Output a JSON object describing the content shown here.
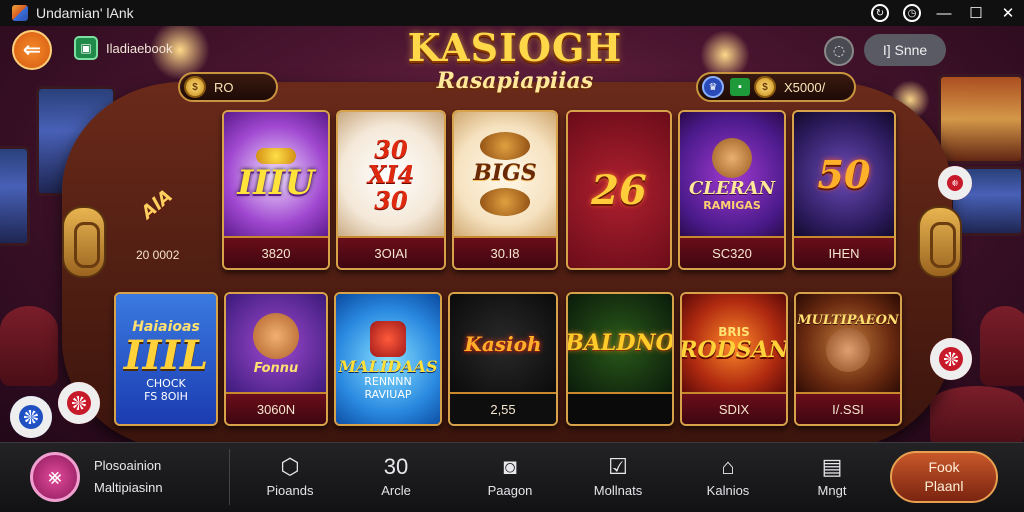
{
  "window": {
    "title": "Undamian' lAnk"
  },
  "header": {
    "back_icon": "arrow-left-icon",
    "book_label": "Iladiaebook",
    "logo_title": "KASIOGH",
    "logo_subtitle": "Rasapiapiias",
    "sign_label": "I] Snne"
  },
  "balances": {
    "left_value": "RO",
    "right_value": "X5000/"
  },
  "table": {
    "side_text": "AlA",
    "count_label": "20  0002"
  },
  "cards_top": [
    {
      "art": "IIIU",
      "caption": "3820"
    },
    {
      "art": "30\nXI4\n30",
      "caption": "3OIAI"
    },
    {
      "art": "BIGS",
      "caption": "30.I8"
    },
    {
      "art": "26",
      "caption": ""
    },
    {
      "art": "CLERAN",
      "art_sub": "RAMIGAS",
      "caption": "SC320"
    },
    {
      "art": "50",
      "caption": "IHEN"
    }
  ],
  "cards_bottom": [
    {
      "art_sub": "Haiaioas",
      "art": "IIIL",
      "art_sub2": "CHOCK\nFS 8OIH",
      "caption": ""
    },
    {
      "art": "Fonnu",
      "caption": "3060N"
    },
    {
      "art": "MALIDAAS",
      "art_sub": "RENNNN\nRAVIUAP",
      "caption": ""
    },
    {
      "art": "Kasioh",
      "caption": "2,55"
    },
    {
      "art": "BALDNO",
      "caption": ""
    },
    {
      "art_sub": "BRIS",
      "art": "RODSAN",
      "caption": "SDIX"
    },
    {
      "art": "MULTIPAEON",
      "caption": "I/.SSI"
    }
  ],
  "bottom_nav": {
    "promo_line1": "Plosoainion",
    "promo_line2": "Maltipiasinn",
    "items": [
      {
        "label": "Pioands",
        "icon": "chip-icon"
      },
      {
        "label": "Arcle",
        "icon": "30"
      },
      {
        "label": "Paagon",
        "icon": "camera-icon"
      },
      {
        "label": "Mollnats",
        "icon": "check-badge-icon"
      },
      {
        "label": "Kalnios",
        "icon": "house-icon"
      },
      {
        "label": "Mngt",
        "icon": "shop-icon"
      }
    ],
    "cta_line1": "Fook",
    "cta_line2": "Plaanl"
  }
}
